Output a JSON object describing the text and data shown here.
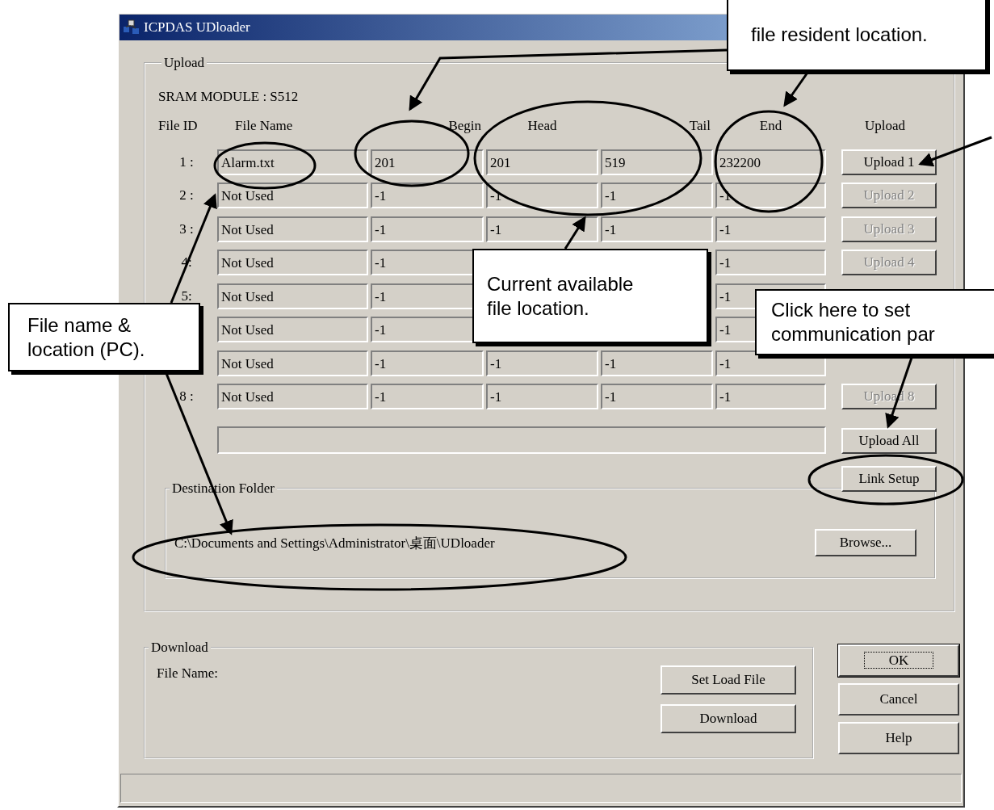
{
  "window": {
    "title": "ICPDAS UDloader"
  },
  "upload": {
    "legend": "Upload",
    "module": "SRAM MODULE : S512",
    "columns": [
      "File ID",
      "File Name",
      "Begin",
      "Head",
      "Tail",
      "End",
      "Upload"
    ],
    "rows": [
      {
        "id": "1 :",
        "file": "Alarm.txt",
        "begin": "201",
        "head": "201",
        "tail": "519",
        "end": "232200",
        "upload": {
          "label": "Upload 1",
          "disabled": false
        }
      },
      {
        "id": "2 :",
        "file": "Not Used",
        "begin": "-1",
        "head": "-1",
        "tail": "-1",
        "end": "-1",
        "upload": {
          "label": "Upload 2",
          "disabled": true
        }
      },
      {
        "id": "3 :",
        "file": "Not Used",
        "begin": "-1",
        "head": "-1",
        "tail": "-1",
        "end": "-1",
        "upload": {
          "label": "Upload 3",
          "disabled": true
        }
      },
      {
        "id": "4:",
        "file": "Not Used",
        "begin": "-1",
        "end": "-1",
        "upload": {
          "label": "Upload 4",
          "disabled": true
        }
      },
      {
        "id": "5:",
        "file": "Not Used",
        "begin": "-1",
        "end": "-1"
      },
      {
        "file": "Not Used",
        "begin": "-1",
        "end": "-1"
      },
      {
        "file": "Not Used",
        "begin": "-1",
        "head": "-1",
        "tail": "-1",
        "end": "-1"
      },
      {
        "id": "8 :",
        "file": "Not Used",
        "begin": "-1",
        "head": "-1",
        "tail": "-1",
        "end": "-1",
        "upload": {
          "label": "Upload 8",
          "disabled": true
        }
      }
    ],
    "upload_all": "Upload All",
    "link_setup": "Link Setup",
    "destination": {
      "legend": "Destination Folder",
      "path": "C:\\Documents and Settings\\Administrator\\桌面\\UDloader",
      "browse": "Browse..."
    }
  },
  "download": {
    "legend": "Download",
    "file_label": "File Name:",
    "set_load_file": "Set Load File",
    "download": "Download"
  },
  "buttons": [
    {
      "label": "OK",
      "default": true
    },
    {
      "label": "Cancel",
      "default": false
    },
    {
      "label": "Help",
      "default": false
    }
  ],
  "callouts": [
    {
      "lines": [
        "file resident location."
      ]
    },
    {
      "lines": [
        "Current available",
        "file location."
      ]
    },
    {
      "lines": [
        "File name &",
        "location (PC)."
      ]
    },
    {
      "lines": [
        "Click here to set",
        "communication par"
      ]
    }
  ]
}
